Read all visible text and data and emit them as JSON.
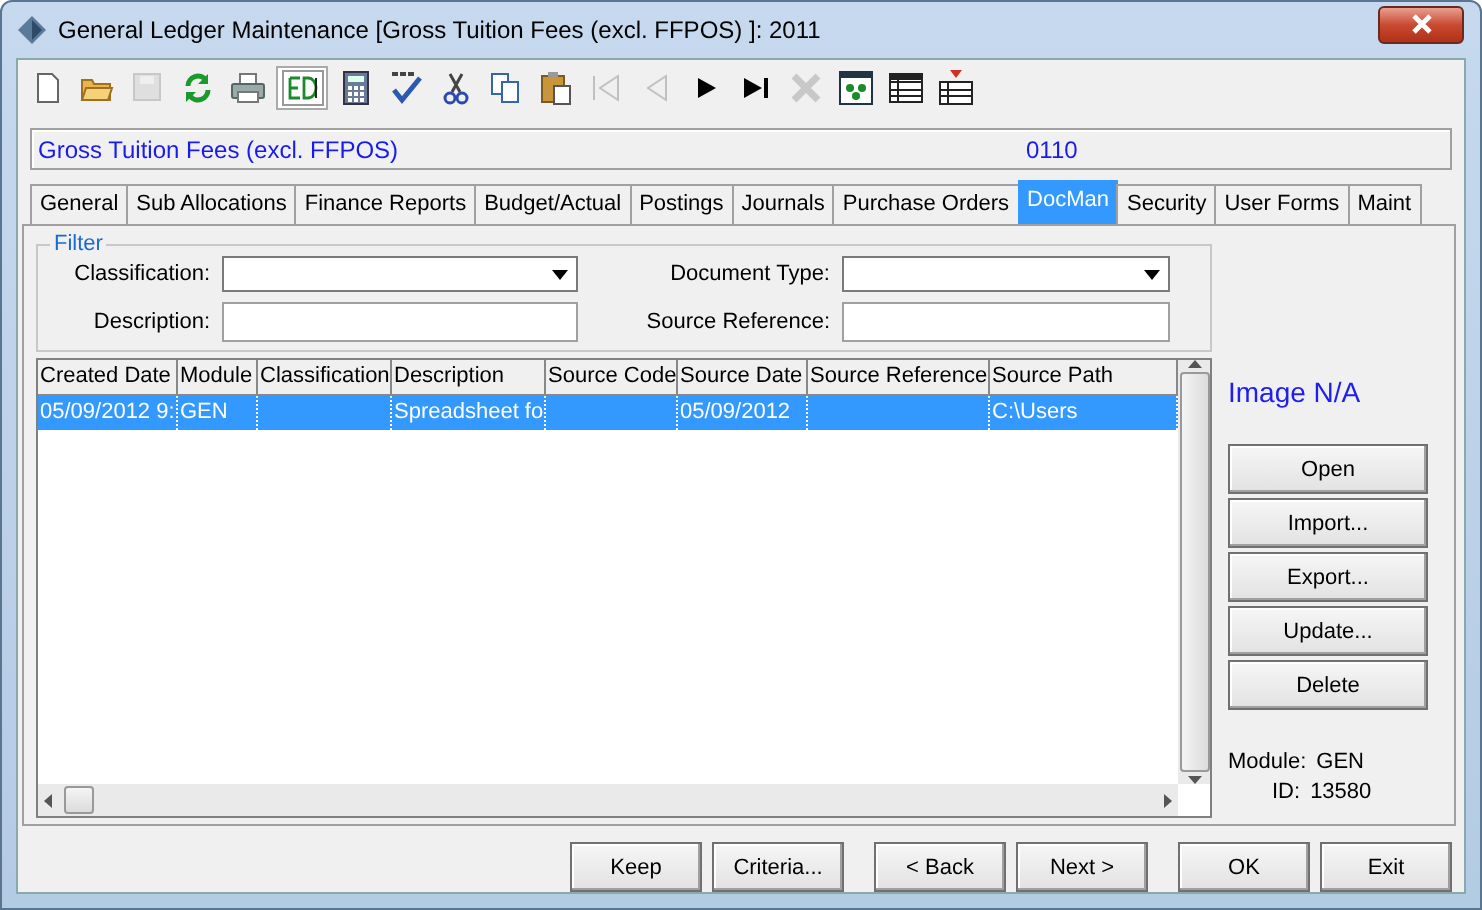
{
  "window": {
    "title": "General Ledger Maintenance  [Gross Tuition Fees (excl. FFPOS) ]:  2011"
  },
  "toolbar": [
    {
      "kind": "new",
      "disabled": false
    },
    {
      "kind": "open",
      "disabled": false
    },
    {
      "kind": "save",
      "disabled": true
    },
    {
      "kind": "refresh",
      "disabled": false
    },
    {
      "kind": "print",
      "disabled": false
    },
    {
      "kind": "edit",
      "disabled": false
    },
    {
      "kind": "calculator",
      "disabled": false
    },
    {
      "kind": "spell",
      "disabled": false
    },
    {
      "kind": "cut",
      "disabled": false
    },
    {
      "kind": "copy",
      "disabled": false
    },
    {
      "kind": "paste",
      "disabled": false
    },
    {
      "kind": "first",
      "disabled": true
    },
    {
      "kind": "prev",
      "disabled": true
    },
    {
      "kind": "next",
      "disabled": false
    },
    {
      "kind": "last",
      "disabled": false
    },
    {
      "kind": "delete",
      "disabled": true
    },
    {
      "kind": "dots",
      "disabled": false
    },
    {
      "kind": "grid",
      "disabled": false
    },
    {
      "kind": "gridmark",
      "disabled": false
    }
  ],
  "header": {
    "account_name": "Gross Tuition Fees (excl. FFPOS)",
    "account_code": "0110"
  },
  "tabs": [
    {
      "label": "General",
      "selected": false
    },
    {
      "label": "Sub Allocations",
      "selected": false
    },
    {
      "label": "Finance Reports",
      "selected": false
    },
    {
      "label": "Budget/Actual",
      "selected": false
    },
    {
      "label": "Postings",
      "selected": false
    },
    {
      "label": "Journals",
      "selected": false
    },
    {
      "label": "Purchase Orders",
      "selected": false
    },
    {
      "label": "DocMan",
      "selected": true
    },
    {
      "label": "Security",
      "selected": false
    },
    {
      "label": "User Forms",
      "selected": false
    },
    {
      "label": "Maint",
      "selected": false
    }
  ],
  "filter": {
    "title": "Filter",
    "fields": [
      {
        "label": "Classification:",
        "kind": "dropdown"
      },
      {
        "label": "Document Type:",
        "kind": "dropdown"
      },
      {
        "label": "Description:",
        "kind": "text"
      },
      {
        "label": "Source Reference:",
        "kind": "text"
      }
    ]
  },
  "table": {
    "columns": [
      "Created Date",
      "Module",
      "Classification",
      "Description",
      "Source Code",
      "Source Date",
      "Source Reference",
      "Source Path"
    ],
    "rows": [
      {
        "cells": [
          "05/09/2012 9:",
          "GEN",
          "",
          "Spreadsheet fo",
          "",
          "05/09/2012",
          "",
          "C:\\Users"
        ],
        "selected": true
      }
    ]
  },
  "image_status": "Image N/A",
  "side_buttons": [
    "Open",
    "Import...",
    "Export...",
    "Update...",
    "Delete"
  ],
  "info": [
    {
      "label": "Module:",
      "value": "GEN"
    },
    {
      "label": "ID:",
      "value": "13580"
    }
  ],
  "footer_buttons": [
    "Keep",
    "Criteria...",
    "< Back",
    "Next >",
    "OK",
    "Exit"
  ]
}
